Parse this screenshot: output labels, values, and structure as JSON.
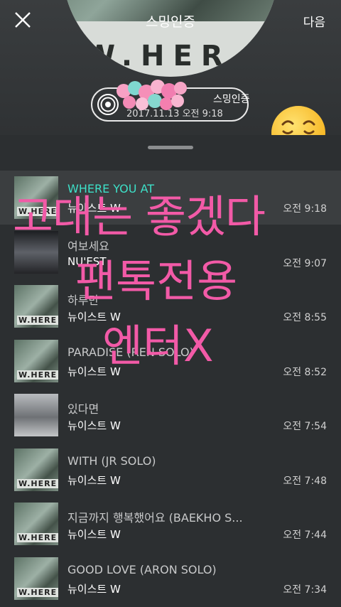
{
  "header": {
    "title": "스밍인증",
    "next_label": "다음",
    "album_art_text": "W.HER"
  },
  "badge": {
    "label": "스밍인증",
    "datetime": "2017.11.13 오전 9:18"
  },
  "list": {
    "partial_header": "",
    "items": [
      {
        "title": "WHERE YOU AT",
        "artist": "뉴이스트 W",
        "time": "오전 9:18",
        "thumb": "where",
        "active": true
      },
      {
        "title": "여보세요",
        "artist": "NU'EST",
        "time": "오전 9:07",
        "thumb": "dark",
        "active": false
      },
      {
        "title": "하루만",
        "artist": "뉴이스트 W",
        "time": "오전 8:55",
        "thumb": "where",
        "active": false
      },
      {
        "title": "PARADISE (REN SOLO)",
        "artist": "뉴이스트 W",
        "time": "오전 8:52",
        "thumb": "where",
        "active": false
      },
      {
        "title": "있다면",
        "artist": "뉴이스트 W",
        "time": "오전 7:54",
        "thumb": "grey",
        "active": false
      },
      {
        "title": "WITH (JR SOLO)",
        "artist": "뉴이스트 W",
        "time": "오전 7:48",
        "thumb": "where",
        "active": false
      },
      {
        "title": "지금까지 행복했어요 (BAEKHO S...",
        "artist": "뉴이스트 W",
        "time": "오전 7:44",
        "thumb": "where",
        "active": false
      },
      {
        "title": "GOOD LOVE (ARON SOLO)",
        "artist": "뉴이스트 W",
        "time": "오전 7:34",
        "thumb": "where",
        "active": false
      }
    ]
  },
  "overlay": {
    "line1": "고대는 좋겠다",
    "line2": "팬톡전용",
    "line3": "엔터X",
    "color": "#f25aa7"
  }
}
